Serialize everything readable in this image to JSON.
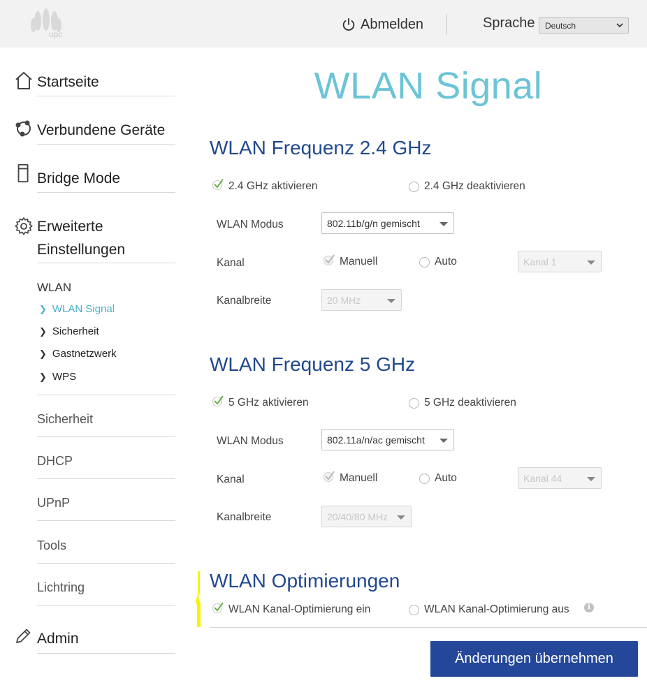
{
  "header": {
    "logo_text": "upc",
    "logout_label": "Abmelden",
    "language_label": "Sprache",
    "language_selected": "Deutsch"
  },
  "sidebar": {
    "main_items": [
      {
        "label": "Startseite",
        "icon": "home-icon"
      },
      {
        "label": "Verbundene Geräte",
        "icon": "devices-icon"
      },
      {
        "label": "Bridge Mode",
        "icon": "bridge-icon"
      },
      {
        "label_line1": "Erweiterte",
        "label_line2": "Einstellungen",
        "icon": "gear-icon"
      }
    ],
    "wlan_heading": "WLAN",
    "wlan_items": [
      "WLAN Signal",
      "Sicherheit",
      "Gastnetzwerk",
      "WPS"
    ],
    "links": [
      "Sicherheit",
      "DHCP",
      "UPnP",
      "Tools",
      "Lichtring"
    ],
    "admin": {
      "label": "Admin",
      "icon": "pencil-icon"
    }
  },
  "main": {
    "title": "WLAN Signal",
    "band24": {
      "title": "WLAN Frequenz 2.4 GHz",
      "enable_label": "2.4 GHz aktivieren",
      "disable_label": "2.4 GHz deaktivieren",
      "mode_label": "WLAN Modus",
      "mode_value": "802.11b/g/n gemischt",
      "channel_label": "Kanal",
      "manual_label": "Manuell",
      "auto_label": "Auto",
      "channel_value": "Kanal 1",
      "width_label": "Kanalbreite",
      "width_value": "20 MHz"
    },
    "band5": {
      "title": "WLAN Frequenz 5 GHz",
      "enable_label": "5 GHz aktivieren",
      "disable_label": "5 GHz deaktivieren",
      "mode_label": "WLAN Modus",
      "mode_value": "802.11a/n/ac gemischt",
      "channel_label": "Kanal",
      "manual_label": "Manuell",
      "auto_label": "Auto",
      "channel_value": "Kanal 44",
      "width_label": "Kanalbreite",
      "width_value": "20/40/80 MHz"
    },
    "optimization": {
      "title": "WLAN Optimierungen",
      "on_label": "WLAN Kanal-Optimierung ein",
      "off_label": "WLAN Kanal-Optimierung aus",
      "info_glyph": "i"
    },
    "apply_label": "Änderungen übernehmen"
  },
  "colors": {
    "title_accent": "#6cc4d6",
    "section_title": "#20498f",
    "active_link": "#4bb1c8",
    "check_green": "#6ab04c",
    "button_bg": "#24479a",
    "highlight": "#f5f500"
  }
}
